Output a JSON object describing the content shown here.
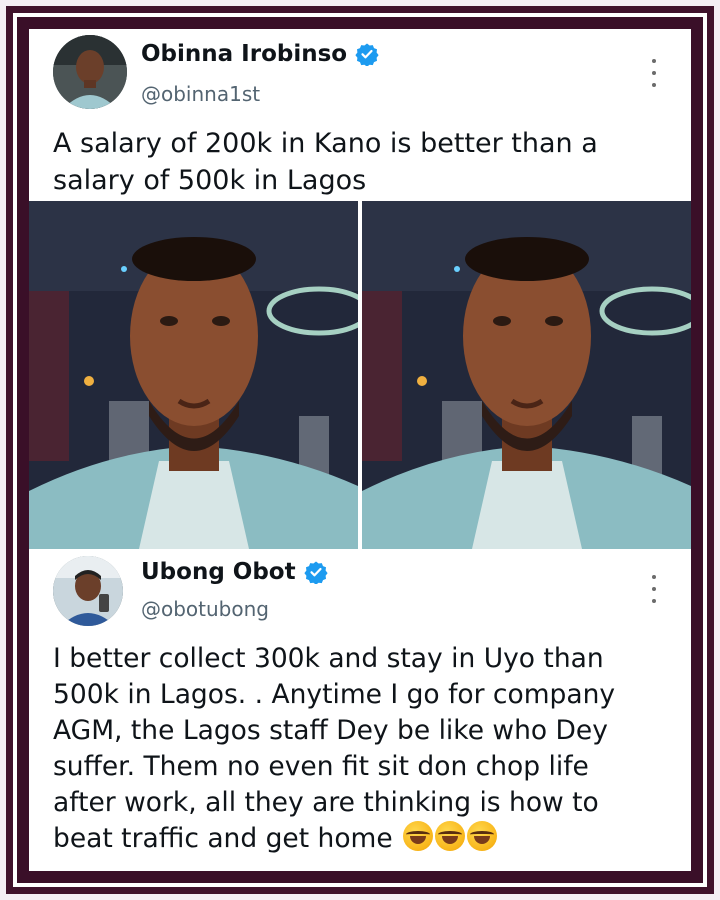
{
  "tweet1": {
    "name": "Obinna Irobinso",
    "handle": "@obinna1st",
    "text_line1": "A salary of 200k in Kano is better than a",
    "text_line2": "salary of 500k in Lagos",
    "verified": true
  },
  "tweet2": {
    "name": "Ubong Obot",
    "handle": "@obotubong",
    "text_lines": [
      "I better collect 300k and stay in Uyo than",
      "500k in Lagos. . Anytime I go for company",
      "AGM, the Lagos staff Dey be like who Dey",
      "suffer. Them no even fit sit don chop life",
      "after work, all they are thinking is how to",
      "beat traffic and get home"
    ],
    "emoji_count": 3,
    "verified": true
  },
  "colors": {
    "frame": "#3a0f28",
    "verified_blue": "#1d9bf0",
    "text": "#0f1419",
    "muted": "#536471"
  }
}
